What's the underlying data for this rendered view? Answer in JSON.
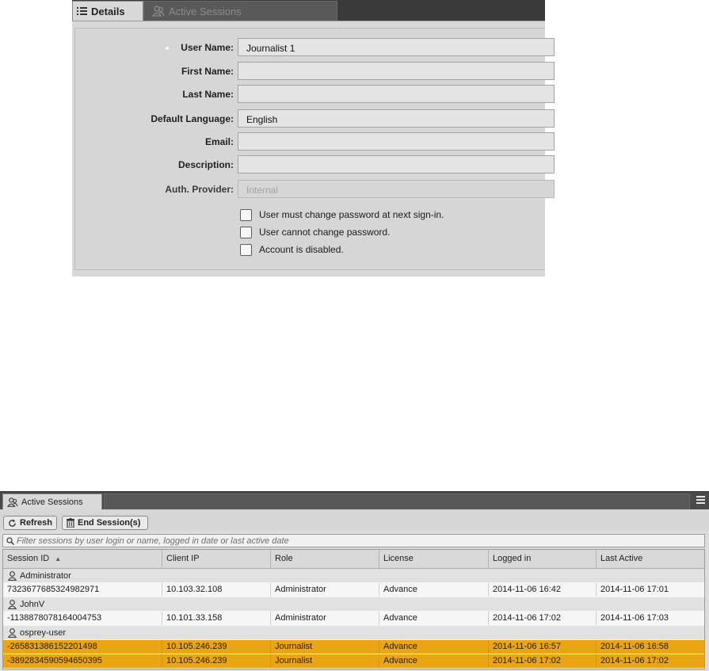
{
  "details_panel": {
    "tabs": [
      {
        "label": "Details",
        "icon": "list-icon",
        "active": true
      },
      {
        "label": "Active Sessions",
        "icon": "users-icon",
        "active": false
      }
    ],
    "fields": {
      "user_name": {
        "label": "User Name:",
        "value": "Journalist 1",
        "required": true
      },
      "first_name": {
        "label": "First Name:",
        "value": ""
      },
      "last_name": {
        "label": "Last Name:",
        "value": ""
      },
      "default_language": {
        "label": "Default Language:",
        "value": "English"
      },
      "email": {
        "label": "Email:",
        "value": ""
      },
      "description": {
        "label": "Description:",
        "value": ""
      },
      "auth_provider": {
        "label": "Auth. Provider:",
        "value": "Internal",
        "disabled": true
      }
    },
    "checkboxes": [
      {
        "label": "User must change password at next sign-in.",
        "checked": false
      },
      {
        "label": "User cannot change password.",
        "checked": false
      },
      {
        "label": "Account is disabled.",
        "checked": false
      }
    ]
  },
  "sessions_panel": {
    "tab_label": "Active Sessions",
    "menu_icon": "hamburger-icon",
    "toolbar": {
      "refresh_label": "Refresh",
      "end_sessions_label": "End Session(s)"
    },
    "filter_placeholder": "Filter sessions by user login or name, logged in date or last active date",
    "columns": [
      "Session ID",
      "Client IP",
      "Role",
      "License",
      "Logged in",
      "Last Active"
    ],
    "sort_column": "Session ID",
    "sort_direction": "ascending",
    "groups": [
      {
        "user": "Administrator",
        "sessions": [
          {
            "session_id": "7323677685324982971",
            "client_ip": "10.103.32.108",
            "role": "Administrator",
            "license": "Advance",
            "logged_in": "2014-11-06 16:42",
            "last_active": "2014-11-06 17:01",
            "selected": false
          }
        ]
      },
      {
        "user": "JohnV",
        "sessions": [
          {
            "session_id": "-1138878078164004753",
            "client_ip": "10.101.33.158",
            "role": "Administrator",
            "license": "Advance",
            "logged_in": "2014-11-06 17:02",
            "last_active": "2014-11-06 17:03",
            "selected": false
          }
        ]
      },
      {
        "user": "osprey-user",
        "sessions": [
          {
            "session_id": "-265831386152201498",
            "client_ip": "10.105.246.239",
            "role": "Journalist",
            "license": "Advance",
            "logged_in": "2014-11-06 16:57",
            "last_active": "2014-11-06 16:58",
            "selected": true
          },
          {
            "session_id": "-3892834590594650395",
            "client_ip": "10.105.246.239",
            "role": "Journalist",
            "license": "Advance",
            "logged_in": "2014-11-06 17:02",
            "last_active": "2014-11-06 17:02",
            "selected": true
          }
        ]
      }
    ],
    "colors": {
      "selected_row": "#e9a514",
      "group_row": "#e1e1e1"
    }
  }
}
